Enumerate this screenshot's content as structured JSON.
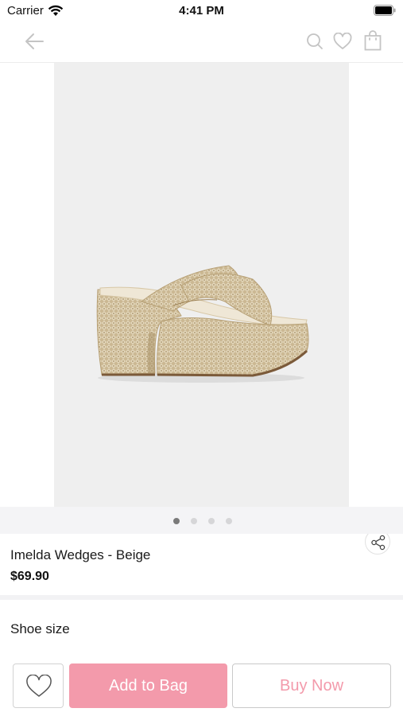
{
  "status_bar": {
    "carrier": "Carrier",
    "time": "4:41 PM"
  },
  "nav": {
    "icons": [
      "back-arrow-icon",
      "search-icon",
      "heart-icon",
      "shopping-bag-icon"
    ]
  },
  "gallery": {
    "image_subject": "beige woven platform wedge sandal",
    "pages": 4,
    "active_page": 1
  },
  "product": {
    "name": "Imelda Wedges - Beige",
    "price": "$69.90"
  },
  "size_section": {
    "label": "Shoe size"
  },
  "actions": {
    "add_to_bag": "Add to Bag",
    "buy_now": "Buy Now"
  },
  "colors": {
    "accent_pink": "#f39aab",
    "image_background": "#efefef"
  }
}
